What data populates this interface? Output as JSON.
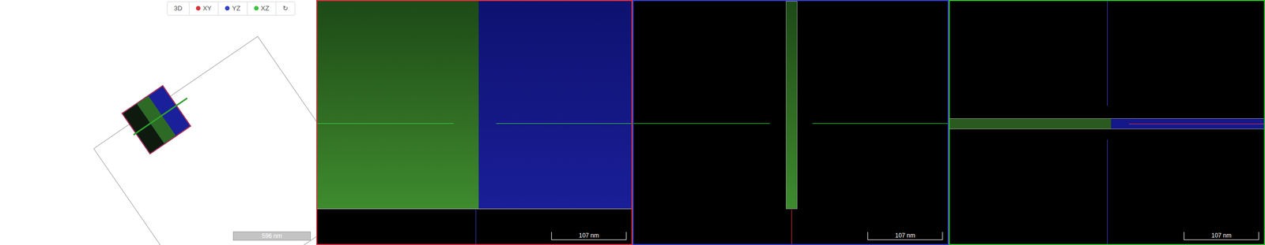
{
  "toolbar": {
    "buttons": [
      {
        "label": "3D",
        "selected": false
      },
      {
        "label": "XY",
        "color": "#d9333f",
        "selected": false
      },
      {
        "label": "YZ",
        "color": "#3140c9",
        "selected": false
      },
      {
        "label": "XZ",
        "color": "#3cc43c",
        "selected": false
      },
      {
        "label": "↻",
        "selected": false
      }
    ]
  },
  "viewport_3d": {
    "scale_bar": "596 nm"
  },
  "panels": [
    {
      "kind": "xy",
      "color": "#e0303f",
      "scale_bar": "107 nm"
    },
    {
      "kind": "yz",
      "color": "#3a3fd0",
      "scale_bar": "107 nm"
    },
    {
      "kind": "xz",
      "color": "#34c034",
      "scale_bar": "107 nm"
    }
  ]
}
